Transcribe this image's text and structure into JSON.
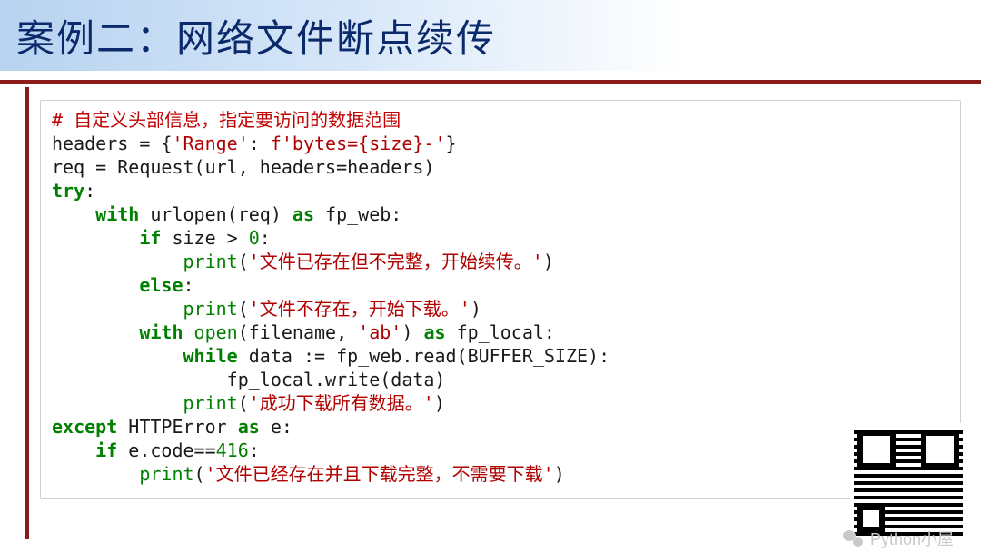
{
  "title": "案例二：网络文件断点续传",
  "code": {
    "l1": "# 自定义头部信息，指定要访问的数据范围",
    "l2a": "headers = {",
    "l2str1": "'Range'",
    "l2b": ": ",
    "l2str2": "f'bytes={size}-'",
    "l2c": "}",
    "l3a": "req = Request(url, headers=headers)",
    "l4a": "try",
    "l4b": ":",
    "l5a": "    ",
    "l5kw": "with",
    "l5b": " urlopen(req) ",
    "l5as": "as",
    "l5c": " fp_web:",
    "l6a": "        ",
    "l6kw": "if",
    "l6b": " size > ",
    "l6n": "0",
    "l6c": ":",
    "l7a": "            ",
    "l7bi": "print",
    "l7b": "(",
    "l7s": "'文件已存在但不完整，开始续传。'",
    "l7c": ")",
    "l8a": "        ",
    "l8kw": "else",
    "l8b": ":",
    "l9a": "            ",
    "l9bi": "print",
    "l9b": "(",
    "l9s": "'文件不存在，开始下载。'",
    "l9c": ")",
    "l10a": "        ",
    "l10kw": "with",
    "l10b": " ",
    "l10bi": "open",
    "l10c": "(filename, ",
    "l10s": "'ab'",
    "l10d": ") ",
    "l10as": "as",
    "l10e": " fp_local:",
    "l11a": "            ",
    "l11kw": "while",
    "l11b": " data := fp_web.read(BUFFER_SIZE):",
    "l12": "                fp_local.write(data)",
    "l13a": "            ",
    "l13bi": "print",
    "l13b": "(",
    "l13s": "'成功下载所有数据。'",
    "l13c": ")",
    "l14a": "except",
    "l14b": " HTTPError ",
    "l14as": "as",
    "l14c": " e:",
    "l15a": "    ",
    "l15kw": "if",
    "l15b": " e.code==",
    "l15n": "416",
    "l15c": ":",
    "l16a": "        ",
    "l16bi": "print",
    "l16b": "(",
    "l16s": "'文件已经存在并且下载完整，不需要下载'",
    "l16c": ")"
  },
  "handle_label": "Python小屋"
}
